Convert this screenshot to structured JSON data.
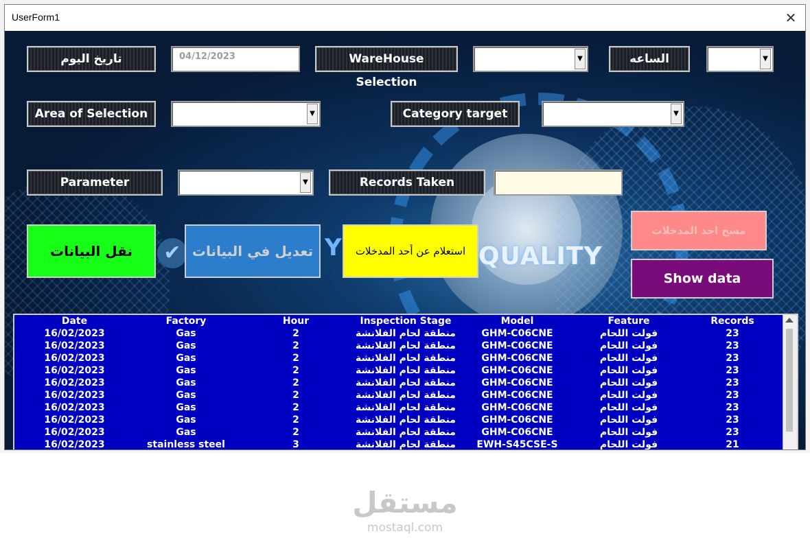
{
  "window": {
    "title": "UserForm1",
    "close_glyph": "✕"
  },
  "labels": {
    "today_date": "تاريخ اليوم",
    "warehouse": "WareHouse Selection",
    "hour": "الساعه",
    "area": "Area of Selection",
    "category": "Category target",
    "parameter": "Parameter",
    "records_taken": "Records Taken"
  },
  "fields": {
    "date_value": "04/12/2023",
    "warehouse_value": "",
    "hour_value": "",
    "area_value": "",
    "category_value": "",
    "parameter_value": "",
    "records_value": ""
  },
  "buttons": {
    "transfer": "نقل البيانات",
    "edit": "تعديل في البيانات",
    "query": "استعلام عن أحد المدخلات",
    "clear": "مسح احد المدخلات",
    "show": "Show data"
  },
  "background": {
    "quality_text": "QUALITY"
  },
  "table": {
    "headers": [
      "Date",
      "Factory",
      "Hour",
      "Inspection Stage",
      "Model",
      "Feature",
      "Records"
    ],
    "rows": [
      [
        "16/02/2023",
        "Gas",
        "2",
        "منطقة لحام الفلانشة",
        "GHM-C06CNE",
        "فولت اللحام",
        "23"
      ],
      [
        "16/02/2023",
        "Gas",
        "2",
        "منطقة لحام الفلانشة",
        "GHM-C06CNE",
        "فولت اللحام",
        "23"
      ],
      [
        "16/02/2023",
        "Gas",
        "2",
        "منطقة لحام الفلانشة",
        "GHM-C06CNE",
        "فولت اللحام",
        "23"
      ],
      [
        "16/02/2023",
        "Gas",
        "2",
        "منطقة لحام الفلانشة",
        "GHM-C06CNE",
        "فولت اللحام",
        "23"
      ],
      [
        "16/02/2023",
        "Gas",
        "2",
        "منطقة لحام الفلانشة",
        "GHM-C06CNE",
        "فولت اللحام",
        "23"
      ],
      [
        "16/02/2023",
        "Gas",
        "2",
        "منطقة لحام الفلانشة",
        "GHM-C06CNE",
        "فولت اللحام",
        "23"
      ],
      [
        "16/02/2023",
        "Gas",
        "2",
        "منطقة لحام الفلانشة",
        "GHM-C06CNE",
        "فولت اللحام",
        "23"
      ],
      [
        "16/02/2023",
        "Gas",
        "2",
        "منطقة لحام الفلانشة",
        "GHM-C06CNE",
        "فولت اللحام",
        "23"
      ],
      [
        "16/02/2023",
        "Gas",
        "2",
        "منطقة لحام الفلانشة",
        "GHM-C06CNE",
        "فولت اللحام",
        "23"
      ],
      [
        "16/02/2023",
        "stainless steel",
        "3",
        "منطقة لحام الفلانشة",
        "EWH-S45CSE-S",
        "فولت اللحام",
        "21"
      ]
    ]
  },
  "watermark": {
    "arabic": "مستقل",
    "latin": "mostaql.com"
  },
  "colors": {
    "transfer_bg": "#17ff17",
    "edit_bg": "#2c7dcc",
    "query_bg": "#ffff00",
    "clear_bg": "#ff8888",
    "show_bg": "#7a0b7a",
    "list_bg": "#0000c0"
  }
}
